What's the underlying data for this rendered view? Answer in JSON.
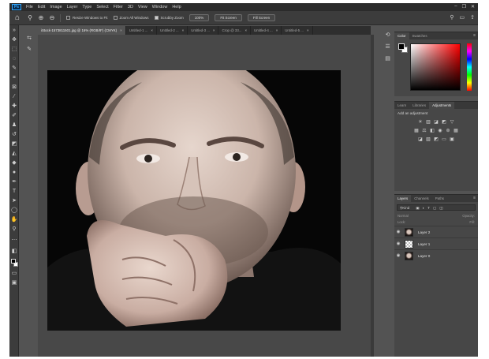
{
  "menu": {
    "logo": "Ps",
    "items": [
      "File",
      "Edit",
      "Image",
      "Layer",
      "Type",
      "Select",
      "Filter",
      "3D",
      "View",
      "Window",
      "Help"
    ],
    "window_controls": [
      "–",
      "❐",
      "✕"
    ]
  },
  "options_bar": {
    "checks": [
      {
        "label": "Resize Windows to Fit",
        "checked": false
      },
      {
        "label": "Zoom All Windows",
        "checked": false
      },
      {
        "label": "Scrubby Zoom",
        "checked": true
      }
    ],
    "zoom_value": "100%",
    "buttons": [
      "Fit Screen",
      "Fill Screen"
    ]
  },
  "tabs": [
    {
      "label": "iStock-1573811501.jpg @ 16% (RGB/8*) (CMYK)",
      "active": true
    },
    {
      "label": "Untitled-1 ...",
      "active": false
    },
    {
      "label": "Untitled-2 ...",
      "active": false
    },
    {
      "label": "Untitled-3 ...",
      "active": false
    },
    {
      "label": "Crop @ 33...",
      "active": false
    },
    {
      "label": "Untitled-4 ...",
      "active": false
    },
    {
      "label": "Untitled-5 ...",
      "active": false
    }
  ],
  "color_panel": {
    "tabs": [
      "Color",
      "Swatches"
    ],
    "foreground": "#000000",
    "background": "#ffffff"
  },
  "adjustments_panel": {
    "tabs": [
      "Learn",
      "Libraries",
      "Adjustments"
    ],
    "title": "Add an adjustment"
  },
  "layers_panel": {
    "tabs": [
      "Layers",
      "Channels",
      "Paths"
    ],
    "filter_label": "Kind",
    "blend_mode": "Normal",
    "opacity_label": "Opacity:",
    "lock_label": "Lock:",
    "fill_label": "Fill:",
    "layers": [
      {
        "name": "Layer 2",
        "thumb": "face"
      },
      {
        "name": "Layer 1",
        "thumb": "checker"
      },
      {
        "name": "Layer 0",
        "thumb": "face"
      }
    ]
  }
}
